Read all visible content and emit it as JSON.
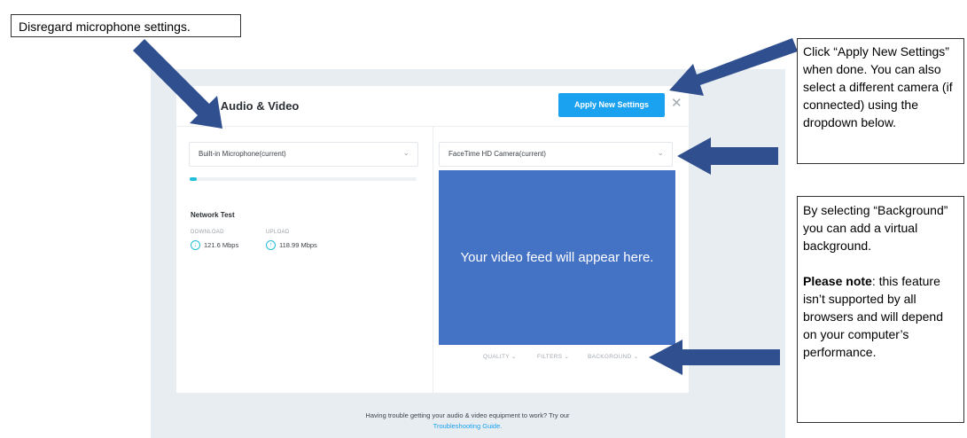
{
  "dialog": {
    "title": "Your Audio & Video",
    "apply_label": "Apply New Settings",
    "close_glyph": "✕"
  },
  "microphone": {
    "selected": "Built-in Microphone(current)",
    "level": 0.03
  },
  "network": {
    "title": "Network Test",
    "download_label": "DOWNLOAD",
    "download_value": "121.6 Mbps",
    "upload_label": "UPLOAD",
    "upload_value": "118.99 Mbps"
  },
  "camera": {
    "selected": "FaceTime HD Camera(current)",
    "placeholder": "Your video feed will appear here.",
    "options": [
      "QUALITY",
      "FILTERS",
      "BACKGROUND"
    ]
  },
  "footer": {
    "text": "Having trouble getting your audio & video equipment to work? Try our",
    "link": "Troubleshooting Guide."
  },
  "callouts": {
    "mic_note": "Disregard microphone settings.",
    "apply_note": "Click “Apply New Settings” when done. You can also select a different camera (if connected) using the dropdown below.",
    "background_note": "By selecting “Background” you can add a virtual background.",
    "please_note_bold": "Please note",
    "please_note_rest": ": this feature isn’t supported by all browsers and will depend on your computer’s performance."
  },
  "colors": {
    "accent": "#1aa1f0",
    "video_bg": "#4472c4",
    "arrow": "#2f4f8f",
    "level": "#22bfd8"
  },
  "icons": {
    "close": "close-icon",
    "dropdown": "chevron-down-icon",
    "network": "arrow-circle-icon"
  }
}
